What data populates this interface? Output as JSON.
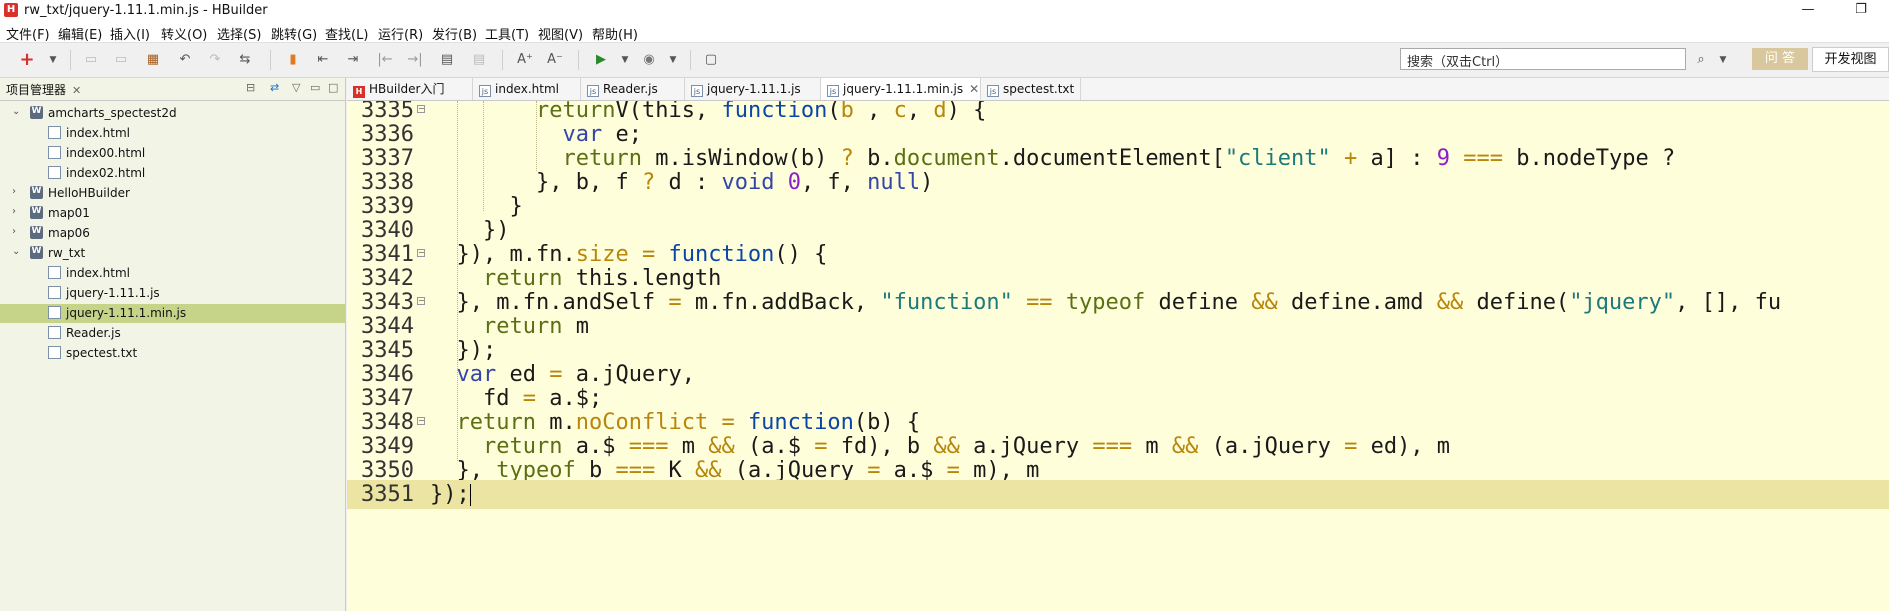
{
  "window": {
    "title": "rw_txt/jquery-1.11.1.min.js  -  HBuilder",
    "app_icon": "H",
    "minimize_glyph": "—",
    "maximize_glyph": "❐"
  },
  "menu": [
    "文件(F)",
    "编辑(E)",
    "插入(I)",
    "转义(O)",
    "选择(S)",
    "跳转(G)",
    "查找(L)",
    "运行(R)",
    "发行(B)",
    "工具(T)",
    "视图(V)",
    "帮助(H)"
  ],
  "toolbar": {
    "search_placeholder": "搜索（双击Ctrl）",
    "qa_label": "问 答",
    "dev_view_label": "开发视图"
  },
  "project_panel": {
    "tab_label": "项目管理器",
    "close_glyph": "✕",
    "tree": [
      {
        "label": "amcharts_spectest2d",
        "kind": "project",
        "depth": 0,
        "expanded": true
      },
      {
        "label": "index.html",
        "kind": "file",
        "depth": 1
      },
      {
        "label": "index00.html",
        "kind": "file",
        "depth": 1
      },
      {
        "label": "index02.html",
        "kind": "file",
        "depth": 1
      },
      {
        "label": "HelloHBuilder",
        "kind": "project",
        "depth": 0,
        "expanded": false
      },
      {
        "label": "map01",
        "kind": "project",
        "depth": 0,
        "expanded": false
      },
      {
        "label": "map06",
        "kind": "project",
        "depth": 0,
        "expanded": false
      },
      {
        "label": "rw_txt",
        "kind": "project",
        "depth": 0,
        "expanded": true
      },
      {
        "label": "index.html",
        "kind": "file",
        "depth": 1
      },
      {
        "label": "jquery-1.11.1.js",
        "kind": "file",
        "depth": 1
      },
      {
        "label": "jquery-1.11.1.min.js",
        "kind": "file",
        "depth": 1,
        "selected": true
      },
      {
        "label": "Reader.js",
        "kind": "file",
        "depth": 1
      },
      {
        "label": "spectest.txt",
        "kind": "file",
        "depth": 1
      }
    ]
  },
  "editor_tabs": [
    {
      "label": "HBuilder入门",
      "icon": "h"
    },
    {
      "label": "index.html",
      "icon": "f"
    },
    {
      "label": "Reader.js",
      "icon": "f"
    },
    {
      "label": "jquery-1.11.1.js",
      "icon": "f"
    },
    {
      "label": "jquery-1.11.1.min.js",
      "icon": "f",
      "active": true
    },
    {
      "label": "spectest.txt",
      "icon": "f"
    }
  ],
  "code_lines": [
    {
      "n": "3335",
      "fold": true
    },
    {
      "n": "3336",
      "fold": false
    },
    {
      "n": "3337",
      "fold": false
    },
    {
      "n": "3338",
      "fold": false
    },
    {
      "n": "3339",
      "fold": false
    },
    {
      "n": "3340",
      "fold": false
    },
    {
      "n": "3341",
      "fold": true
    },
    {
      "n": "3342",
      "fold": false
    },
    {
      "n": "3343",
      "fold": true
    },
    {
      "n": "3344",
      "fold": false
    },
    {
      "n": "3345",
      "fold": false
    },
    {
      "n": "3346",
      "fold": false
    },
    {
      "n": "3347",
      "fold": false
    },
    {
      "n": "3348",
      "fold": true
    },
    {
      "n": "3349",
      "fold": false
    },
    {
      "n": "3350",
      "fold": false
    },
    {
      "n": "3351",
      "fold": false,
      "current": true
    }
  ],
  "code_segments": [
    [
      [
        "kw",
        "return"
      ],
      [
        "",
        "V(this, "
      ],
      [
        "fn",
        "function"
      ],
      [
        "",
        "("
      ],
      [
        "prop",
        "b"
      ],
      [
        "",
        " ,"
      ],
      [
        "prop",
        " c"
      ],
      [
        "",
        ", "
      ],
      [
        "prop",
        "d"
      ],
      [
        "",
        ") {"
      ]
    ],
    [
      [
        "kw2",
        "var"
      ],
      [
        "",
        " e;"
      ]
    ],
    [
      [
        "kw",
        "return"
      ],
      [
        "",
        " m.isWindow(b) "
      ],
      [
        "prop",
        "?"
      ],
      [
        "",
        " b."
      ],
      [
        "kw",
        "document"
      ],
      [
        "",
        ".documentElement["
      ],
      [
        "str",
        "\"client\""
      ],
      [
        "",
        " "
      ],
      [
        "prop",
        "+"
      ],
      [
        "",
        " a] : "
      ],
      [
        "num",
        "9"
      ],
      [
        "",
        " "
      ],
      [
        "prop",
        "==="
      ],
      [
        "",
        " b.nodeType ?"
      ]
    ],
    [
      [
        "",
        "}, b, f "
      ],
      [
        "prop",
        "?"
      ],
      [
        "",
        " d : "
      ],
      [
        "kw2",
        "void"
      ],
      [
        "",
        " "
      ],
      [
        "num",
        "0"
      ],
      [
        "",
        ", f, "
      ],
      [
        "kw2",
        "null"
      ],
      [
        "",
        ")"
      ]
    ],
    [
      [
        "",
        "}"
      ]
    ],
    [
      [
        "",
        "})"
      ]
    ],
    [
      [
        "",
        "}), m.fn."
      ],
      [
        "prop",
        "size"
      ],
      [
        "",
        " "
      ],
      [
        "prop",
        "="
      ],
      [
        "",
        " "
      ],
      [
        "fn",
        "function"
      ],
      [
        "",
        "() {"
      ]
    ],
    [
      [
        "kw",
        "return"
      ],
      [
        "",
        " this.length"
      ]
    ],
    [
      [
        "",
        "}, m.fn.andSelf "
      ],
      [
        "prop",
        "="
      ],
      [
        "",
        " m.fn.addBack, "
      ],
      [
        "str",
        "\"function\""
      ],
      [
        "",
        " "
      ],
      [
        "prop",
        "=="
      ],
      [
        "",
        " "
      ],
      [
        "kw",
        "typeof"
      ],
      [
        "",
        " define "
      ],
      [
        "prop",
        "&&"
      ],
      [
        "",
        " define.amd "
      ],
      [
        "prop",
        "&&"
      ],
      [
        "",
        " define("
      ],
      [
        "str",
        "\"jquery\""
      ],
      [
        "",
        ", [], fu"
      ]
    ],
    [
      [
        "kw",
        "return"
      ],
      [
        "",
        " m"
      ]
    ],
    [
      [
        "",
        "});"
      ]
    ],
    [
      [
        "kw2",
        "var"
      ],
      [
        "",
        " ed "
      ],
      [
        "prop",
        "="
      ],
      [
        "",
        " a.jQuery,"
      ]
    ],
    [
      [
        "",
        "fd "
      ],
      [
        "prop",
        "="
      ],
      [
        "",
        " a.$;"
      ]
    ],
    [
      [
        "kw",
        "return"
      ],
      [
        "",
        " m."
      ],
      [
        "prop",
        "noConflict"
      ],
      [
        "",
        " "
      ],
      [
        "prop",
        "="
      ],
      [
        "",
        " "
      ],
      [
        "fn",
        "function"
      ],
      [
        "",
        "(b) {"
      ]
    ],
    [
      [
        "kw",
        "return"
      ],
      [
        "",
        " a.$ "
      ],
      [
        "prop",
        "==="
      ],
      [
        "",
        " m "
      ],
      [
        "prop",
        "&&"
      ],
      [
        "",
        " (a.$ "
      ],
      [
        "prop",
        "="
      ],
      [
        "",
        " fd), b "
      ],
      [
        "prop",
        "&&"
      ],
      [
        "",
        " a.jQuery "
      ],
      [
        "prop",
        "==="
      ],
      [
        "",
        " m "
      ],
      [
        "prop",
        "&&"
      ],
      [
        "",
        " (a.jQuery "
      ],
      [
        "prop",
        "="
      ],
      [
        "",
        " ed), m"
      ]
    ],
    [
      [
        "",
        "}, "
      ],
      [
        "kw",
        "typeof"
      ],
      [
        "",
        " b "
      ],
      [
        "prop",
        "==="
      ],
      [
        "",
        " K "
      ],
      [
        "prop",
        "&&"
      ],
      [
        "",
        " (a.jQuery "
      ],
      [
        "prop",
        "="
      ],
      [
        "",
        " a.$ "
      ],
      [
        "prop",
        "="
      ],
      [
        "",
        " m), m"
      ]
    ],
    [
      [
        "",
        "});"
      ]
    ]
  ]
}
